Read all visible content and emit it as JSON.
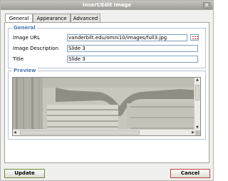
{
  "window": {
    "title": "Insert/Edit Image",
    "close_glyph": "×"
  },
  "tabs": [
    {
      "label": "General",
      "active": true
    },
    {
      "label": "Appearance",
      "active": false
    },
    {
      "label": "Advanced",
      "active": false
    }
  ],
  "general": {
    "legend": "General",
    "fields": [
      {
        "label": "Image URL",
        "value": "vanderbilt.edu/omni10/images/full3.jpg"
      },
      {
        "label": "Image Description",
        "value": "Slide 3"
      },
      {
        "label": "Title",
        "value": "Slide 3"
      }
    ]
  },
  "preview": {
    "legend": "Preview"
  },
  "buttons": {
    "update": "Update",
    "cancel": "Cancel"
  },
  "colors": {
    "legend": "#4a7ab8",
    "update_border": "#6a8c3a",
    "cancel_border": "#b8443c"
  }
}
